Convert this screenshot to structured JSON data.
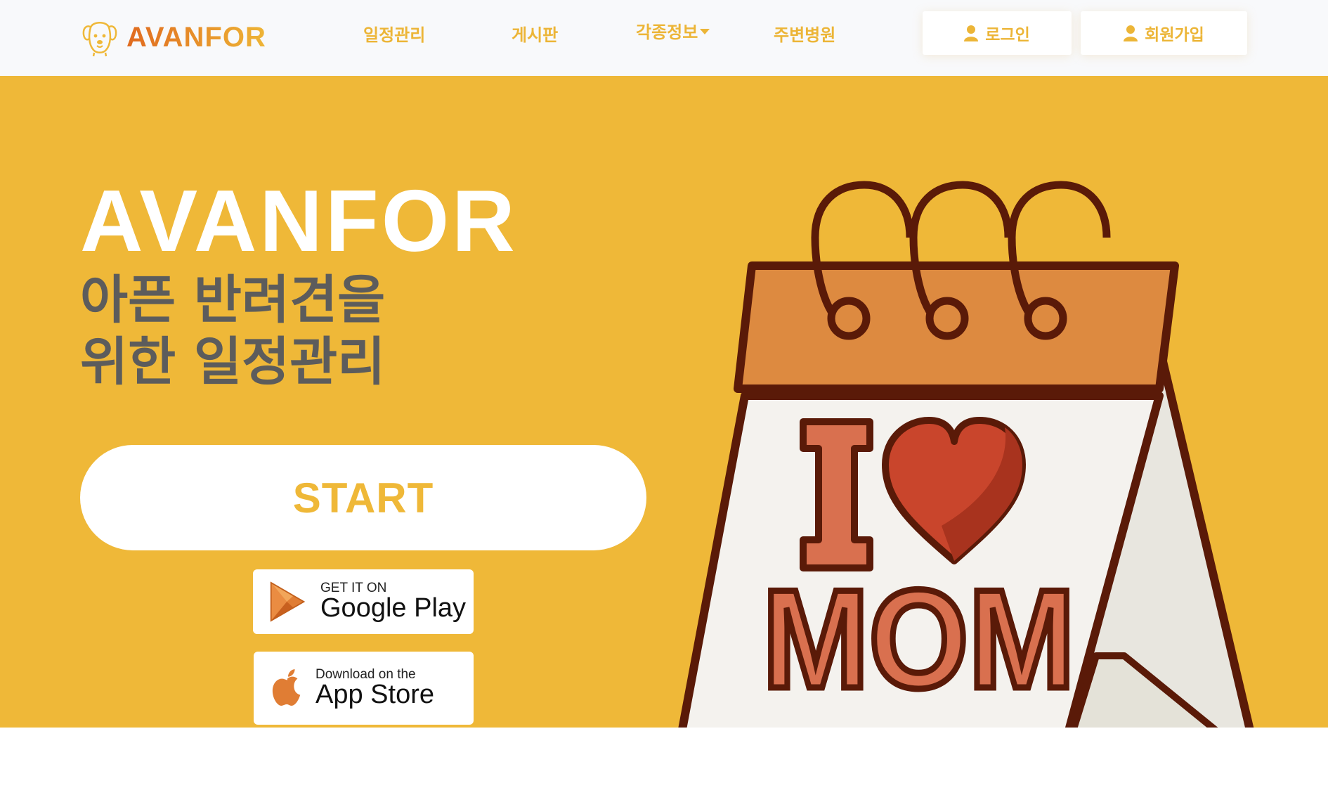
{
  "header": {
    "brand": "AVANFOR",
    "nav": [
      {
        "label": "일정관리"
      },
      {
        "label": "게시판"
      },
      {
        "label": "각종정보"
      },
      {
        "label": "주변병원"
      }
    ],
    "login_label": "로그인",
    "signup_label": "회원가입"
  },
  "hero": {
    "title": "AVANFOR",
    "subtitle": "아픈 반려견을\n위한 일정관리",
    "start_label": "START",
    "google_play": {
      "small": "GET IT ON",
      "big": "Google Play"
    },
    "app_store": {
      "small": "Download on the",
      "big": "App Store"
    },
    "illustration": {
      "letter": "I",
      "word": "MOM"
    }
  },
  "colors": {
    "accent": "#efb838",
    "brand_orange": "#e06a1f",
    "text_dark": "#5c5c5c",
    "calendar_top": "#dd8a40",
    "heart": "#c9452c"
  },
  "icons": [
    "dog-logo-icon",
    "user-icon",
    "caret-down-icon",
    "google-play-icon",
    "apple-icon"
  ]
}
